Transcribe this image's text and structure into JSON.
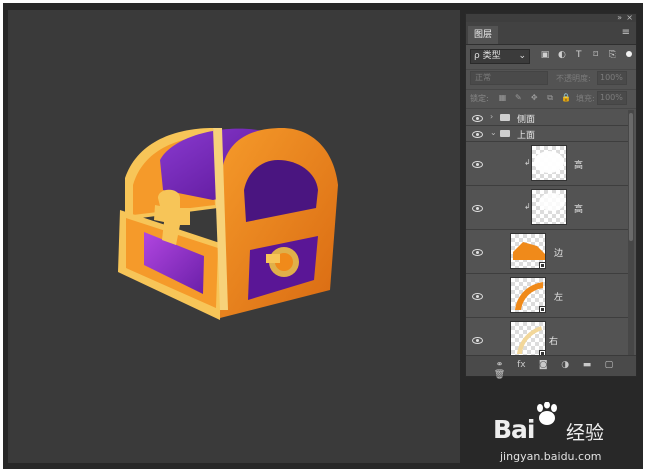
{
  "layers_panel": {
    "tab_title": "图层",
    "filter_label": "ρ 类型",
    "filter_icons": [
      "image-icon",
      "adjustment-icon",
      "type-icon",
      "shape-icon",
      "smart-object-icon"
    ],
    "blend_mode": "正常",
    "opacity_label": "不透明度:",
    "opacity_value": "100%",
    "lock_label": "锁定:",
    "fill_label": "填充:",
    "fill_value": "100%",
    "layers": [
      {
        "type": "group",
        "name": "侧面",
        "expanded": false,
        "visible": true
      },
      {
        "type": "group",
        "name": "上面",
        "expanded": true,
        "visible": true
      },
      {
        "type": "layer",
        "name": "高",
        "clipped": true,
        "visible": true
      },
      {
        "type": "layer",
        "name": "高",
        "clipped": true,
        "visible": true
      },
      {
        "type": "layer",
        "name": "边",
        "mask": true,
        "visible": true
      },
      {
        "type": "layer",
        "name": "左",
        "mask": true,
        "visible": true
      },
      {
        "type": "layer",
        "name": "右",
        "mask": true,
        "visible": true
      }
    ],
    "bottom_icons": [
      "link-layers-icon",
      "fx-icon",
      "add-mask-icon",
      "new-adjustment-icon",
      "new-group-icon",
      "new-layer-icon",
      "delete-icon"
    ]
  },
  "canvas": {
    "artwork": "treasure-chest",
    "colors": {
      "purple": "#6a1fa8",
      "orange": "#f08a1a",
      "gold": "#f7d27a",
      "background": "#3a3a3a"
    }
  },
  "watermark": {
    "brand": "Bai 经验",
    "brand_en": "Bai",
    "brand_cn": "经验",
    "url": "jingyan.baidu.com"
  }
}
